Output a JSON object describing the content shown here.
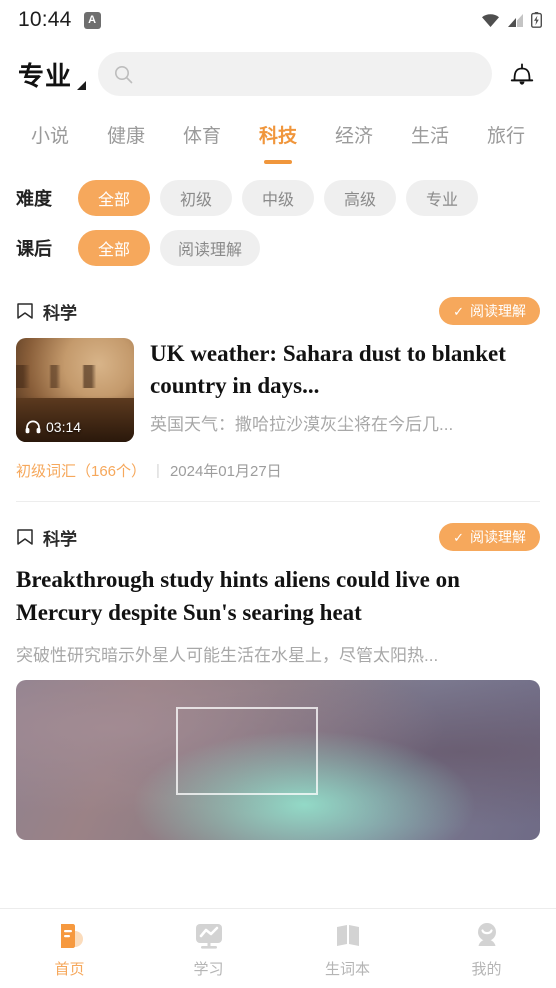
{
  "statusbar": {
    "time": "10:44",
    "app_badge": "A",
    "icons": [
      "wifi-icon",
      "signal-icon",
      "battery-charging-icon"
    ]
  },
  "header": {
    "brand": "专业",
    "caret": "dropdown-caret-icon",
    "search_placeholder": "",
    "search_value": "",
    "search_icon": "search-icon",
    "bell_icon": "bell-icon"
  },
  "tabs": [
    {
      "label": "小说",
      "active": false
    },
    {
      "label": "健康",
      "active": false
    },
    {
      "label": "体育",
      "active": false
    },
    {
      "label": "科技",
      "active": true
    },
    {
      "label": "经济",
      "active": false
    },
    {
      "label": "生活",
      "active": false
    },
    {
      "label": "旅行",
      "active": false
    }
  ],
  "filters": [
    {
      "label": "难度",
      "options": [
        {
          "label": "全部",
          "active": true
        },
        {
          "label": "初级",
          "active": false
        },
        {
          "label": "中级",
          "active": false
        },
        {
          "label": "高级",
          "active": false
        },
        {
          "label": "专业",
          "active": false
        }
      ]
    },
    {
      "label": "课后",
      "options": [
        {
          "label": "全部",
          "active": true
        },
        {
          "label": "阅读理解",
          "active": false
        }
      ]
    }
  ],
  "articles": [
    {
      "category": "科学",
      "category_icon": "tag-icon",
      "badge": "阅读理解",
      "badge_check": "✓",
      "title": "UK weather: Sahara dust to blanket country in days...",
      "subtitle": "英国天气：撒哈拉沙漠灰尘将在今后几...",
      "duration": "03:14",
      "audio_icon": "headphone-icon",
      "vocab": "初级词汇（166个）",
      "separator": "|",
      "date": "2024年01月27日"
    },
    {
      "category": "科学",
      "category_icon": "tag-icon",
      "badge": "阅读理解",
      "badge_check": "✓",
      "title": "Breakthrough study hints aliens could live on Mercury despite Sun's searing heat",
      "subtitle": "突破性研究暗示外星人可能生活在水星上，尽管太阳热..."
    }
  ],
  "bottomnav": [
    {
      "label": "首页",
      "icon": "home-book-icon",
      "active": true
    },
    {
      "label": "学习",
      "icon": "study-monitor-icon",
      "active": false
    },
    {
      "label": "生词本",
      "icon": "open-book-icon",
      "active": false
    },
    {
      "label": "我的",
      "icon": "profile-icon",
      "active": false
    }
  ],
  "colors": {
    "accent": "#f6a85c",
    "accent_text": "#f0963c",
    "chip_bg": "#efefef",
    "muted": "#9b9b9b"
  }
}
